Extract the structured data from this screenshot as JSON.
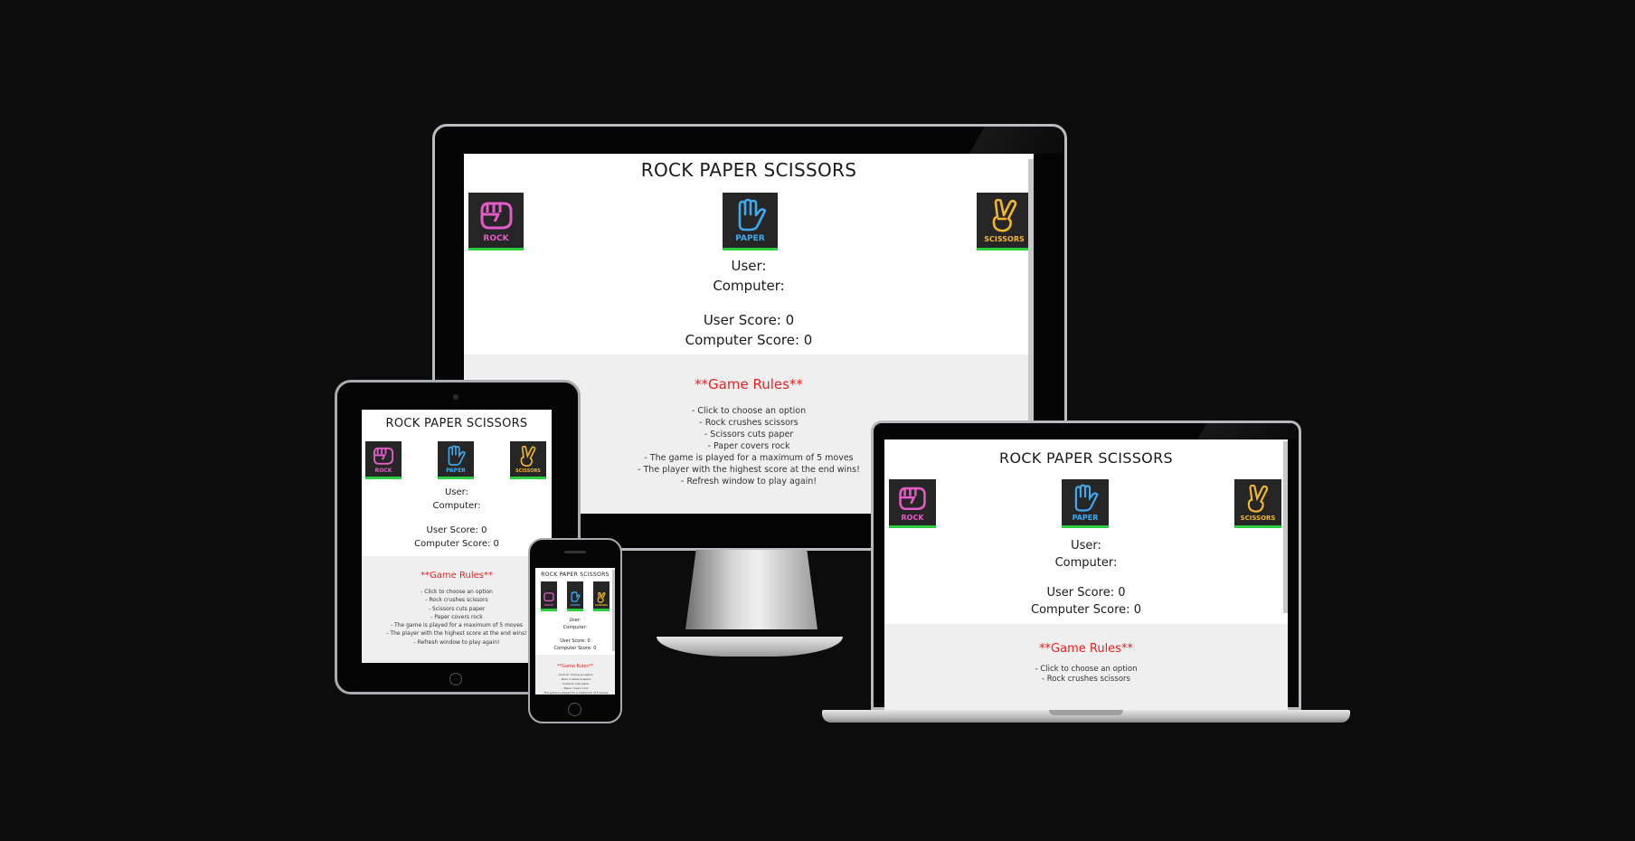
{
  "game": {
    "title": "ROCK PAPER SCISSORS",
    "choices": [
      {
        "label": "ROCK",
        "color": "#e25cc8"
      },
      {
        "label": "PAPER",
        "color": "#3fa9ef"
      },
      {
        "label": "SCISSORS",
        "color": "#f2b52e"
      }
    ],
    "user_label": "User:",
    "computer_label": "Computer:",
    "user_score": "User Score: 0",
    "computer_score": "Computer Score: 0",
    "rules_heading": "**Game Rules**",
    "rules": [
      "- Click to choose an option",
      "- Rock crushes scissors",
      "- Scissors cuts paper",
      "- Paper covers rock",
      "- The game is played for a maximum of 5 moves",
      "- The player with the highest score at the end wins!",
      "- Refresh window to play again!"
    ]
  },
  "colors": {
    "background": "#0c0c0c",
    "rules_heading": "#f01e1e",
    "selection_border": "#2ecc40"
  },
  "icons": [
    "rock-hand-icon",
    "paper-hand-icon",
    "scissors-hand-icon"
  ]
}
